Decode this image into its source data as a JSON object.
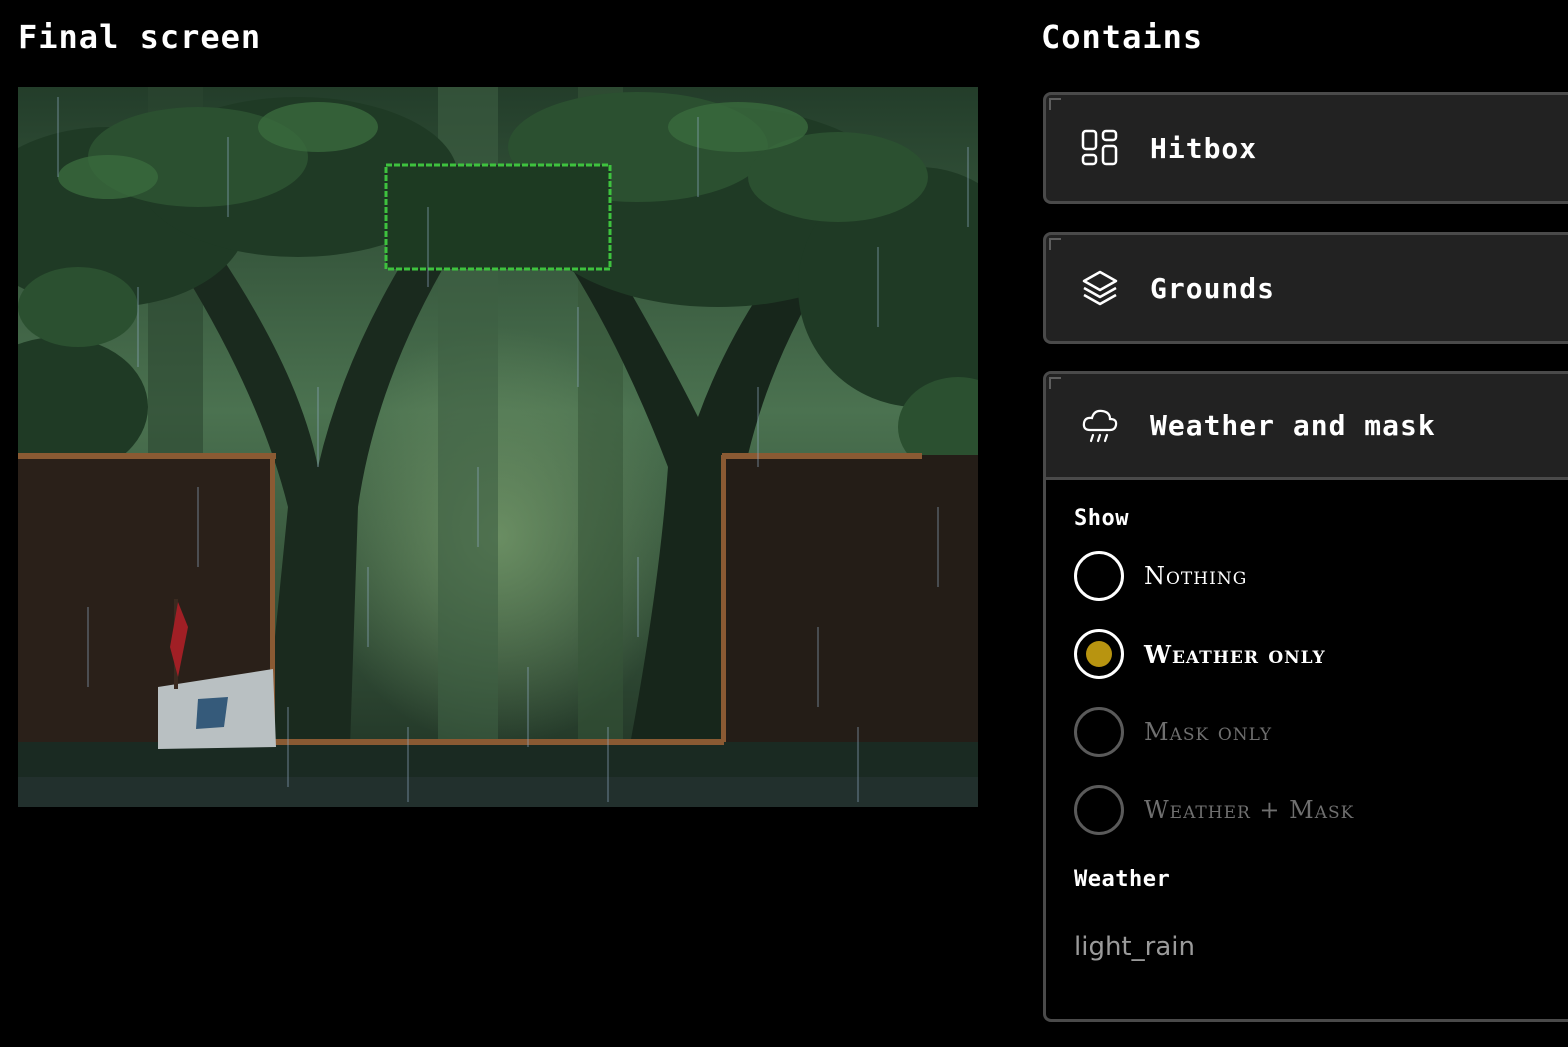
{
  "final_screen": {
    "title": "Final screen"
  },
  "contains": {
    "title": "Contains",
    "panels": [
      {
        "label": "Hitbox",
        "icon": "layout-grid-icon"
      },
      {
        "label": "Grounds",
        "icon": "layers-icon"
      },
      {
        "label": "Weather and mask",
        "icon": "cloud-rain-icon"
      }
    ],
    "weather_mask": {
      "show_label": "Show",
      "options": [
        {
          "label": "Nothing",
          "checked": false,
          "disabled": false
        },
        {
          "label": "Weather only",
          "checked": true,
          "disabled": false
        },
        {
          "label": "Mask only",
          "checked": false,
          "disabled": true
        },
        {
          "label": "Weather + Mask",
          "checked": false,
          "disabled": true
        }
      ],
      "weather_label": "Weather",
      "weather_value": "light_rain"
    }
  },
  "colors": {
    "accent": "#b89410",
    "hitbox_outline": "#3ec23e",
    "panel_bg": "#222222"
  }
}
